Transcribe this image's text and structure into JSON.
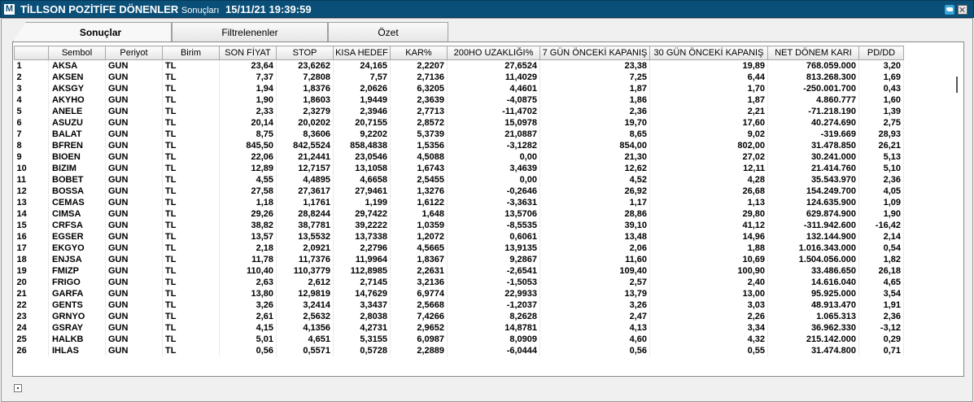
{
  "window": {
    "logo": "M",
    "title": "TİLLSON POZİTİFE DÖNENLER",
    "title_sub": "Sonuçları",
    "timestamp": "15/11/21 19:39:59"
  },
  "tabs": [
    {
      "label": "Sonuçlar",
      "active": true
    },
    {
      "label": "Filtrelenenler",
      "active": false
    },
    {
      "label": "Özet",
      "active": false
    }
  ],
  "columns": [
    "",
    "Sembol",
    "Periyot",
    "Birim",
    "SON FİYAT",
    "STOP",
    "KISA HEDEF",
    "KAR%",
    "200HO UZAKLIĞI%",
    "7 GÜN ÖNCEKİ KAPANIŞ",
    "30 GÜN ÖNCEKİ KAPANIŞ",
    "NET DÖNEM KARI",
    "PD/DD"
  ],
  "rows": [
    [
      "1",
      "AKSA",
      "GUN",
      "TL",
      "23,64",
      "23,6262",
      "24,165",
      "2,2207",
      "27,6524",
      "23,38",
      "19,89",
      "768.059.000",
      "3,20"
    ],
    [
      "2",
      "AKSEN",
      "GUN",
      "TL",
      "7,37",
      "7,2808",
      "7,57",
      "2,7136",
      "11,4029",
      "7,25",
      "6,44",
      "813.268.300",
      "1,69"
    ],
    [
      "3",
      "AKSGY",
      "GUN",
      "TL",
      "1,94",
      "1,8376",
      "2,0626",
      "6,3205",
      "4,4601",
      "1,87",
      "1,70",
      "-250.001.700",
      "0,43"
    ],
    [
      "4",
      "AKYHO",
      "GUN",
      "TL",
      "1,90",
      "1,8603",
      "1,9449",
      "2,3639",
      "-4,0875",
      "1,86",
      "1,87",
      "4.860.777",
      "1,60"
    ],
    [
      "5",
      "ANELE",
      "GUN",
      "TL",
      "2,33",
      "2,3279",
      "2,3946",
      "2,7713",
      "-11,4702",
      "2,36",
      "2,21",
      "-71.218.190",
      "1,39"
    ],
    [
      "6",
      "ASUZU",
      "GUN",
      "TL",
      "20,14",
      "20,0202",
      "20,7155",
      "2,8572",
      "15,0978",
      "19,70",
      "17,60",
      "40.274.690",
      "2,75"
    ],
    [
      "7",
      "BALAT",
      "GUN",
      "TL",
      "8,75",
      "8,3606",
      "9,2202",
      "5,3739",
      "21,0887",
      "8,65",
      "9,02",
      "-319.669",
      "28,93"
    ],
    [
      "8",
      "BFREN",
      "GUN",
      "TL",
      "845,50",
      "842,5524",
      "858,4838",
      "1,5356",
      "-3,1282",
      "854,00",
      "802,00",
      "31.478.850",
      "26,21"
    ],
    [
      "9",
      "BIOEN",
      "GUN",
      "TL",
      "22,06",
      "21,2441",
      "23,0546",
      "4,5088",
      "0,00",
      "21,30",
      "27,02",
      "30.241.000",
      "5,13"
    ],
    [
      "10",
      "BIZIM",
      "GUN",
      "TL",
      "12,89",
      "12,7157",
      "13,1058",
      "1,6743",
      "3,4639",
      "12,62",
      "12,11",
      "21.414.760",
      "5,10"
    ],
    [
      "11",
      "BOBET",
      "GUN",
      "TL",
      "4,55",
      "4,4895",
      "4,6658",
      "2,5455",
      "0,00",
      "4,52",
      "4,28",
      "35.543.970",
      "2,36"
    ],
    [
      "12",
      "BOSSA",
      "GUN",
      "TL",
      "27,58",
      "27,3617",
      "27,9461",
      "1,3276",
      "-0,2646",
      "26,92",
      "26,68",
      "154.249.700",
      "4,05"
    ],
    [
      "13",
      "CEMAS",
      "GUN",
      "TL",
      "1,18",
      "1,1761",
      "1,199",
      "1,6122",
      "-3,3631",
      "1,17",
      "1,13",
      "124.635.900",
      "1,09"
    ],
    [
      "14",
      "CIMSA",
      "GUN",
      "TL",
      "29,26",
      "28,8244",
      "29,7422",
      "1,648",
      "13,5706",
      "28,86",
      "29,80",
      "629.874.900",
      "1,90"
    ],
    [
      "15",
      "CRFSA",
      "GUN",
      "TL",
      "38,82",
      "38,7781",
      "39,2222",
      "1,0359",
      "-8,5535",
      "39,10",
      "41,12",
      "-311.942.600",
      "-16,42"
    ],
    [
      "16",
      "EGSER",
      "GUN",
      "TL",
      "13,57",
      "13,5532",
      "13,7338",
      "1,2072",
      "0,6061",
      "13,48",
      "14,96",
      "132.144.900",
      "2,14"
    ],
    [
      "17",
      "EKGYO",
      "GUN",
      "TL",
      "2,18",
      "2,0921",
      "2,2796",
      "4,5665",
      "13,9135",
      "2,06",
      "1,88",
      "1.016.343.000",
      "0,54"
    ],
    [
      "18",
      "ENJSA",
      "GUN",
      "TL",
      "11,78",
      "11,7376",
      "11,9964",
      "1,8367",
      "9,2867",
      "11,60",
      "10,69",
      "1.504.056.000",
      "1,82"
    ],
    [
      "19",
      "FMIZP",
      "GUN",
      "TL",
      "110,40",
      "110,3779",
      "112,8985",
      "2,2631",
      "-2,6541",
      "109,40",
      "100,90",
      "33.486.650",
      "26,18"
    ],
    [
      "20",
      "FRIGO",
      "GUN",
      "TL",
      "2,63",
      "2,612",
      "2,7145",
      "3,2136",
      "-1,5053",
      "2,57",
      "2,40",
      "14.616.040",
      "4,65"
    ],
    [
      "21",
      "GARFA",
      "GUN",
      "TL",
      "13,80",
      "12,9819",
      "14,7629",
      "6,9774",
      "22,9933",
      "13,79",
      "13,00",
      "95.925.000",
      "3,54"
    ],
    [
      "22",
      "GENTS",
      "GUN",
      "TL",
      "3,26",
      "3,2414",
      "3,3437",
      "2,5668",
      "-1,2037",
      "3,26",
      "3,03",
      "48.913.470",
      "1,91"
    ],
    [
      "23",
      "GRNYO",
      "GUN",
      "TL",
      "2,61",
      "2,5632",
      "2,8038",
      "7,4266",
      "8,2628",
      "2,47",
      "2,26",
      "1.065.313",
      "2,36"
    ],
    [
      "24",
      "GSRAY",
      "GUN",
      "TL",
      "4,15",
      "4,1356",
      "4,2731",
      "2,9652",
      "14,8781",
      "4,13",
      "3,34",
      "36.962.330",
      "-3,12"
    ],
    [
      "25",
      "HALKB",
      "GUN",
      "TL",
      "5,01",
      "4,651",
      "5,3155",
      "6,0987",
      "8,0909",
      "4,60",
      "4,32",
      "215.142.000",
      "0,29"
    ],
    [
      "26",
      "IHLAS",
      "GUN",
      "TL",
      "0,56",
      "0,5571",
      "0,5728",
      "2,2889",
      "-6,0444",
      "0,56",
      "0,55",
      "31.474.800",
      "0,71"
    ]
  ]
}
